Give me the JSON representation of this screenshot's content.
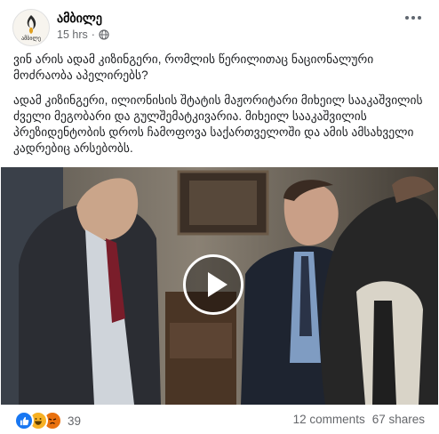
{
  "post": {
    "author": "ამბილე",
    "avatar_text": "ამბილე",
    "time": "15 hrs",
    "dot": "·",
    "more_icon": "more-horizontal-icon",
    "privacy_icon": "globe-icon",
    "paragraph_1": "ვინ არის ადამ კიზინგერი, რომლის წერილითაც ნაციონალური მოძრაობა აპელირებს?",
    "paragraph_2": "ადამ კიზინგერი, ილიონისის შტატის მაჟორიტარი მიხეილ სააკაშვილის ძველი მეგობარი და გულშემატკივარია. მიხეილ სააკაშვილის პრეზიდენტობის დროს ჩამოფოვა საქართველოში და ამის ამსახველი კადრებიც არსებობს."
  },
  "video": {
    "play_icon": "play-icon"
  },
  "footer": {
    "reaction_icons": [
      "like-icon",
      "haha-icon",
      "angry-icon"
    ],
    "reaction_count": "39",
    "comments": "12 comments",
    "shares": "67 shares"
  },
  "colors": {
    "like": "#1877f2",
    "haha": "#f7b125",
    "angry": "#e9710f",
    "meta_text": "#65676b"
  }
}
